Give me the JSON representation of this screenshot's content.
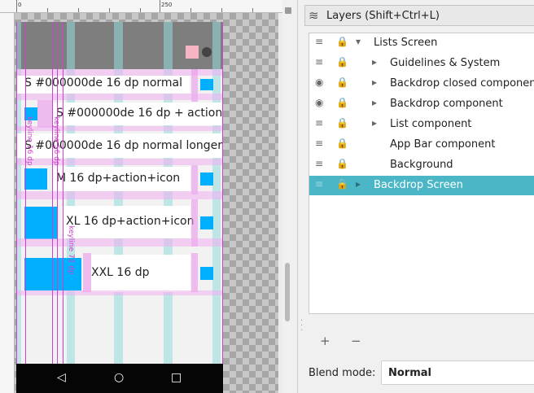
{
  "canvas": {
    "ruler_labels": [
      "0",
      "250"
    ],
    "phone": {
      "rows": [
        {
          "text": "S #000000de 16 dp normal"
        },
        {
          "text": "S #000000de 16 dp + action"
        },
        {
          "text": "S #000000de 16 dp normal longer"
        },
        {
          "text": "M 16 dp+action+icon"
        },
        {
          "text": "XL 16 dp+action+icon"
        },
        {
          "text": "XXL 16 dp"
        }
      ],
      "guide_labels": [
        "keyline 16 dp",
        "keyline 56 dp",
        "keyline 72 dp"
      ],
      "nav_icons": {
        "back": "◁",
        "home": "○",
        "recent": "□"
      }
    }
  },
  "layers_panel": {
    "title": "Layers (Shift+Ctrl+L)",
    "layers": [
      {
        "label": "Lists Screen",
        "visible": false,
        "expanded": true,
        "indent": 0,
        "selected": false
      },
      {
        "label": "Guidelines & System",
        "visible": false,
        "expanded": false,
        "indent": 1,
        "selected": false
      },
      {
        "label": "Backdrop closed component",
        "visible": true,
        "expanded": false,
        "indent": 1,
        "selected": false
      },
      {
        "label": "Backdrop component",
        "visible": true,
        "expanded": false,
        "indent": 1,
        "selected": false
      },
      {
        "label": "List component",
        "visible": false,
        "expanded": false,
        "indent": 1,
        "selected": false
      },
      {
        "label": "App Bar component",
        "visible": false,
        "expanded": null,
        "indent": 1,
        "selected": false
      },
      {
        "label": "Background",
        "visible": false,
        "expanded": null,
        "indent": 1,
        "selected": false
      },
      {
        "label": "Backdrop Screen",
        "visible": false,
        "expanded": false,
        "indent": 0,
        "selected": true
      }
    ],
    "toolbar": {
      "add_label": "+",
      "remove_label": "−"
    },
    "blend": {
      "label": "Blend mode:",
      "value": "Normal"
    }
  },
  "colors": {
    "selection": "#4ab6c6",
    "accent_blue": "#00b0ff",
    "guide_magenta": "#d040d0"
  },
  "icons": {
    "layers": "layers-icon",
    "eye": "eye-icon",
    "lock": "lock-icon",
    "grip": "drag-handle-icon"
  }
}
